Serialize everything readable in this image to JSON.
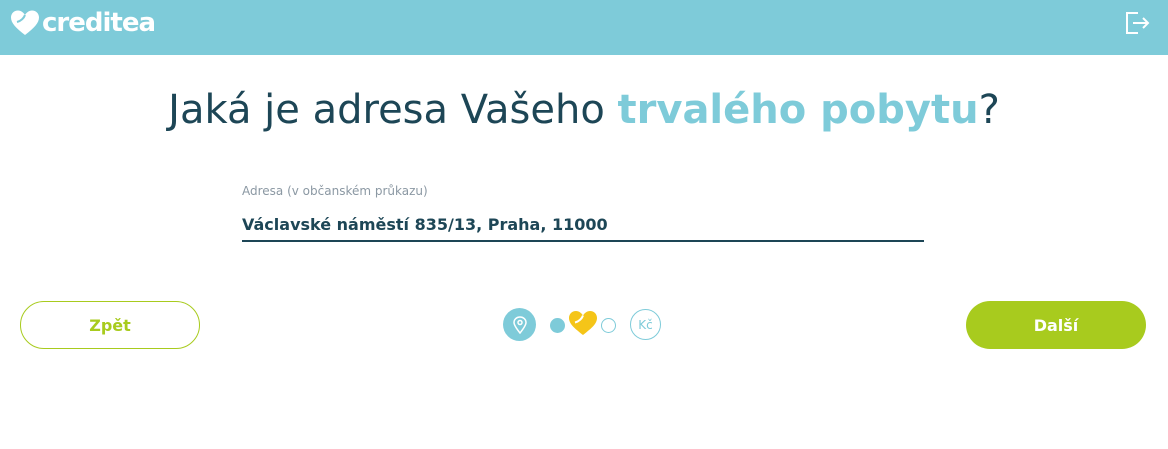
{
  "header": {
    "brand": "creditea",
    "logout_icon": "logout-icon"
  },
  "question": {
    "prefix": "Jaká je adresa Vašeho ",
    "highlight": "trvalého pobytu",
    "suffix": "?"
  },
  "address_field": {
    "label": "Adresa (v občanském průkazu)",
    "value": "Václavské náměstí 835/13, Praha, 11000"
  },
  "navigation": {
    "back_label": "Zpět",
    "next_label": "Další"
  },
  "progress": {
    "current_step_icon": "location-pin-icon",
    "final_step_label": "Kč",
    "steps_total": 5,
    "current_step": 3
  },
  "colors": {
    "brand_teal": "#7ecbd9",
    "dark_text": "#1d4656",
    "accent_green": "#a8cb1e",
    "heart_yellow": "#f5c518"
  }
}
